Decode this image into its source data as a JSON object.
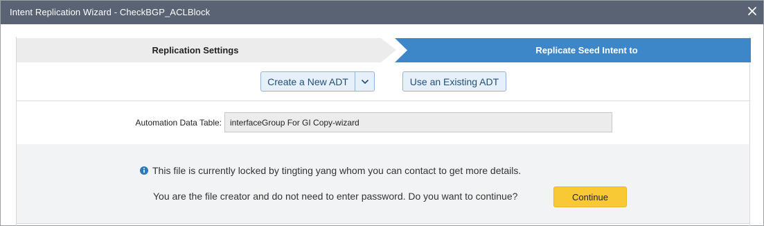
{
  "window": {
    "title": "Intent Replication Wizard - CheckBGP_ACLBlock",
    "close_icon": "close-icon"
  },
  "steps": [
    {
      "label": "Replication Settings",
      "state": "inactive"
    },
    {
      "label": "Replicate Seed Intent to",
      "state": "active"
    }
  ],
  "buttons": {
    "create_new": "Create a New ADT",
    "create_new_caret_icon": "chevron-down-icon",
    "use_existing": "Use an Existing ADT"
  },
  "field": {
    "label": "Automation Data Table:",
    "value": "interfaceGroup For GI Copy-wizard"
  },
  "lock_notice": {
    "info_icon": "info-icon",
    "message": "This file is currently locked by tingting yang whom you can contact to get more details.",
    "question": "You are the file creator and do not need to enter password. Do you want to continue?",
    "continue_label": "Continue"
  },
  "colors": {
    "titlebar": "#596374",
    "active_step": "#3d87c8",
    "inactive_step": "#ececec",
    "continue": "#f8c935",
    "info_icon": "#2b79b9"
  }
}
